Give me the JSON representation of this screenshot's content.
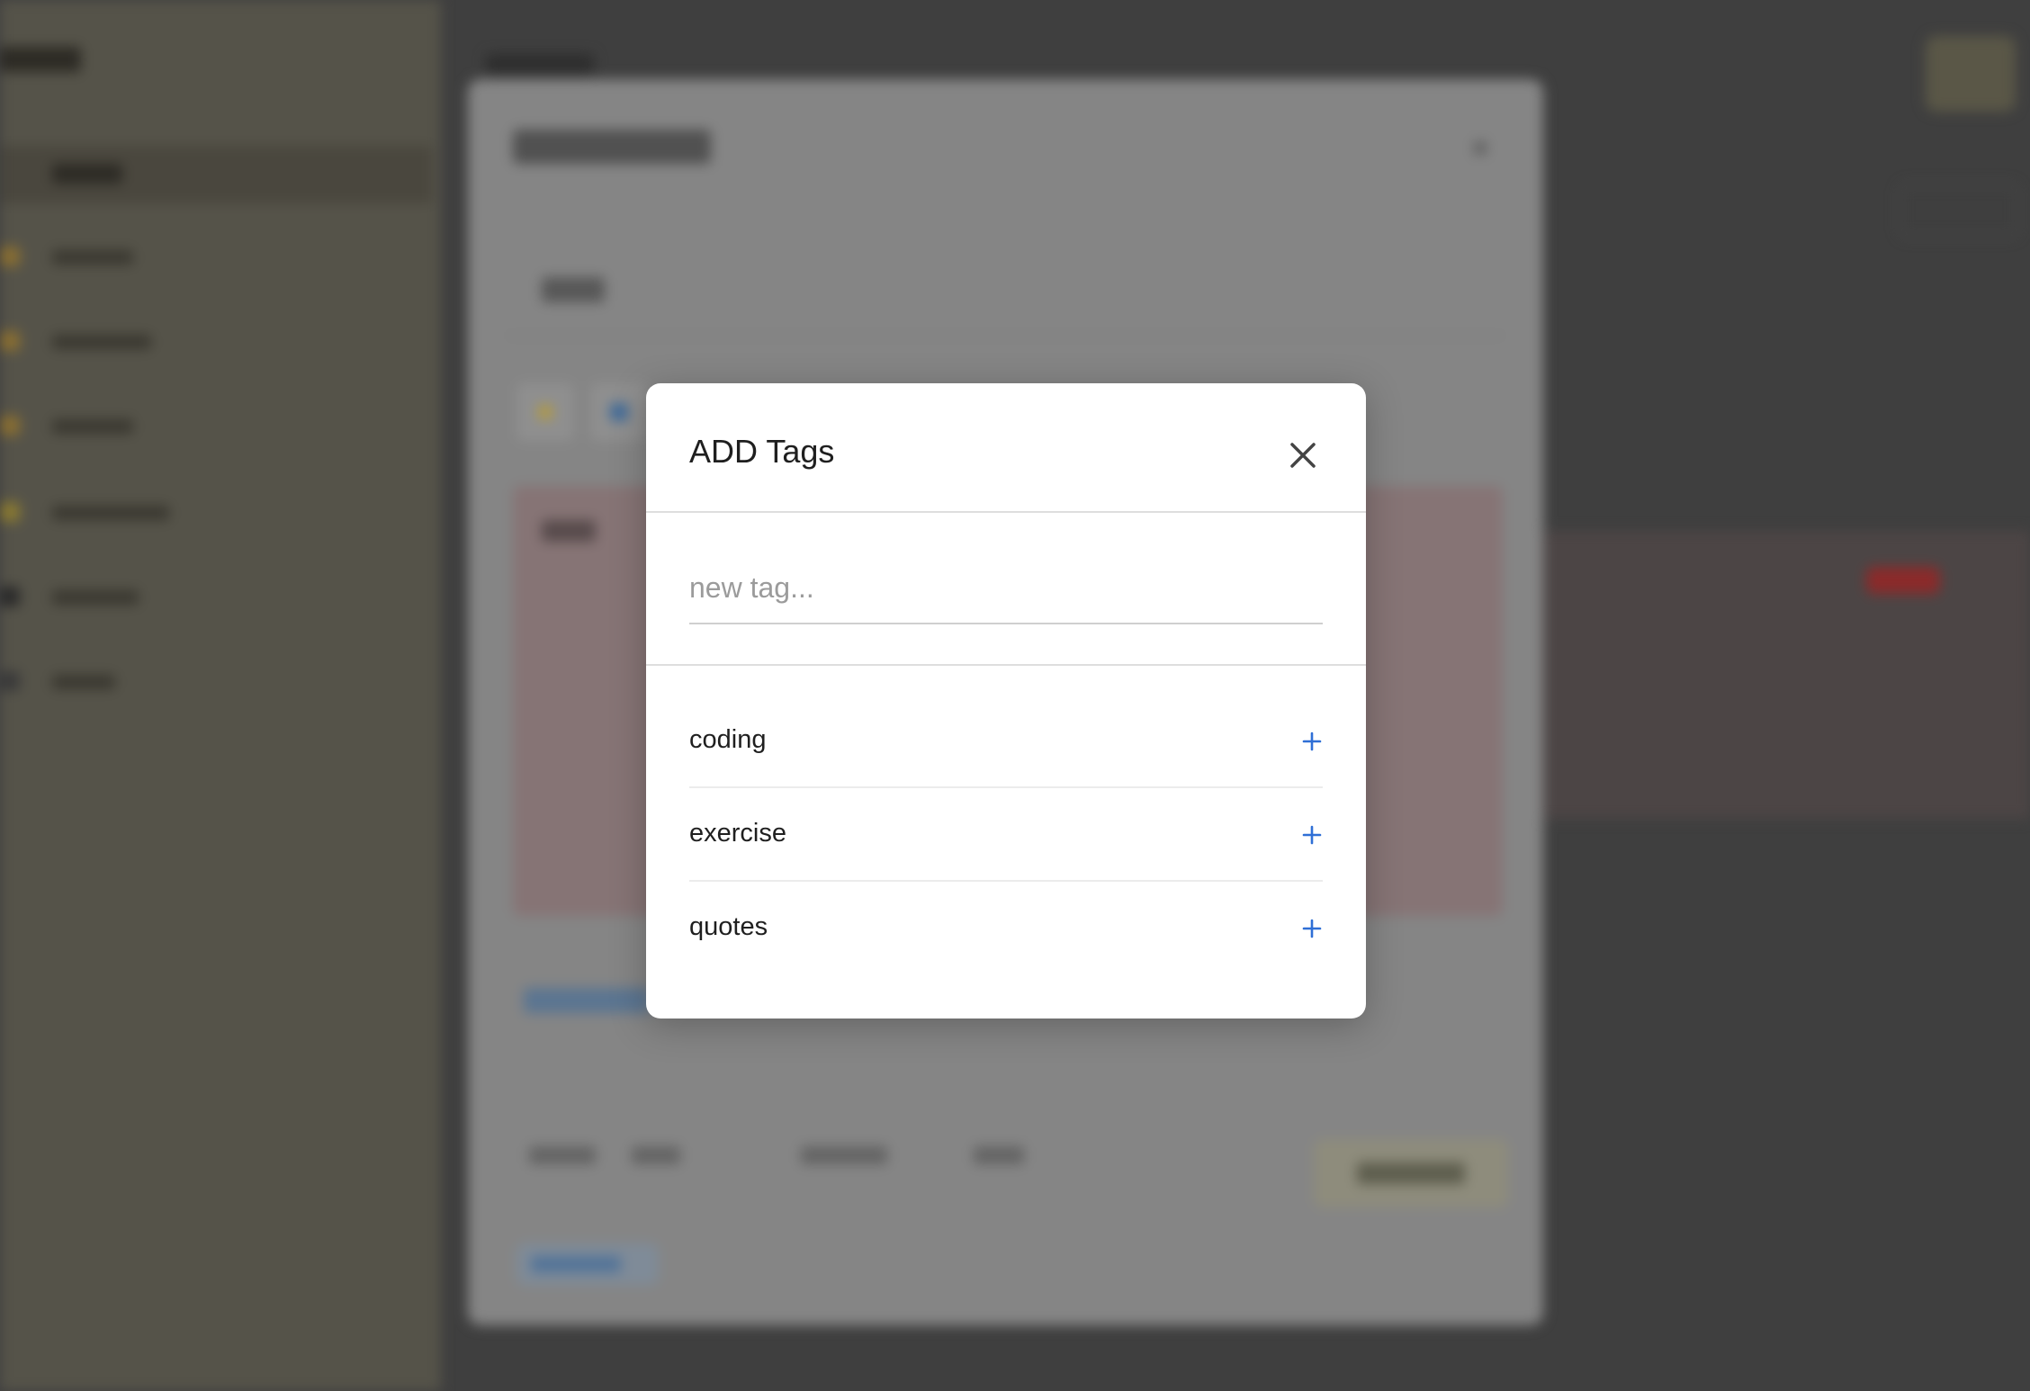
{
  "modal": {
    "title": "ADD Tags",
    "input_placeholder": "new tag...",
    "input_value": "",
    "tags": [
      {
        "name": "coding"
      },
      {
        "name": "exercise"
      },
      {
        "name": "quotes"
      }
    ]
  },
  "colors": {
    "accent": "#2f6fd6",
    "overlay": "#3f3f3f",
    "modal_bg": "#ffffff"
  },
  "icons": {
    "close": "close-icon",
    "add": "plus-icon"
  }
}
